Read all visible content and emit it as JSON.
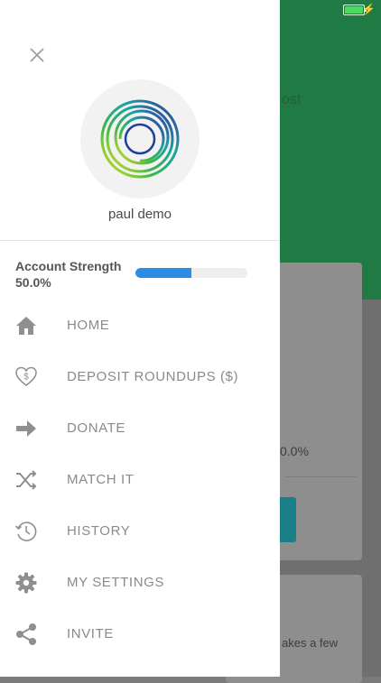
{
  "background": {
    "text_percent": "0.0%",
    "text_partial": "akes a few",
    "text_header": "ost"
  },
  "drawer": {
    "user_name": "paul demo",
    "account_strength_label": "Account Strength",
    "account_strength_value": "50.0%",
    "account_strength_progress": 0.5,
    "menu": [
      {
        "label": "HOME",
        "icon": "home-icon"
      },
      {
        "label": "DEPOSIT ROUNDUPS ($)",
        "icon": "heart-dollar-icon"
      },
      {
        "label": "DONATE",
        "icon": "arrow-right-icon"
      },
      {
        "label": "MATCH IT",
        "icon": "shuffle-icon"
      },
      {
        "label": "HISTORY",
        "icon": "history-icon"
      },
      {
        "label": "MY SETTINGS",
        "icon": "gear-icon"
      },
      {
        "label": "INVITE",
        "icon": "share-icon"
      }
    ]
  },
  "colors": {
    "accent_blue": "#2b8ce6",
    "icon_gray": "#8f8f8f",
    "header_green": "#1f7a43"
  }
}
